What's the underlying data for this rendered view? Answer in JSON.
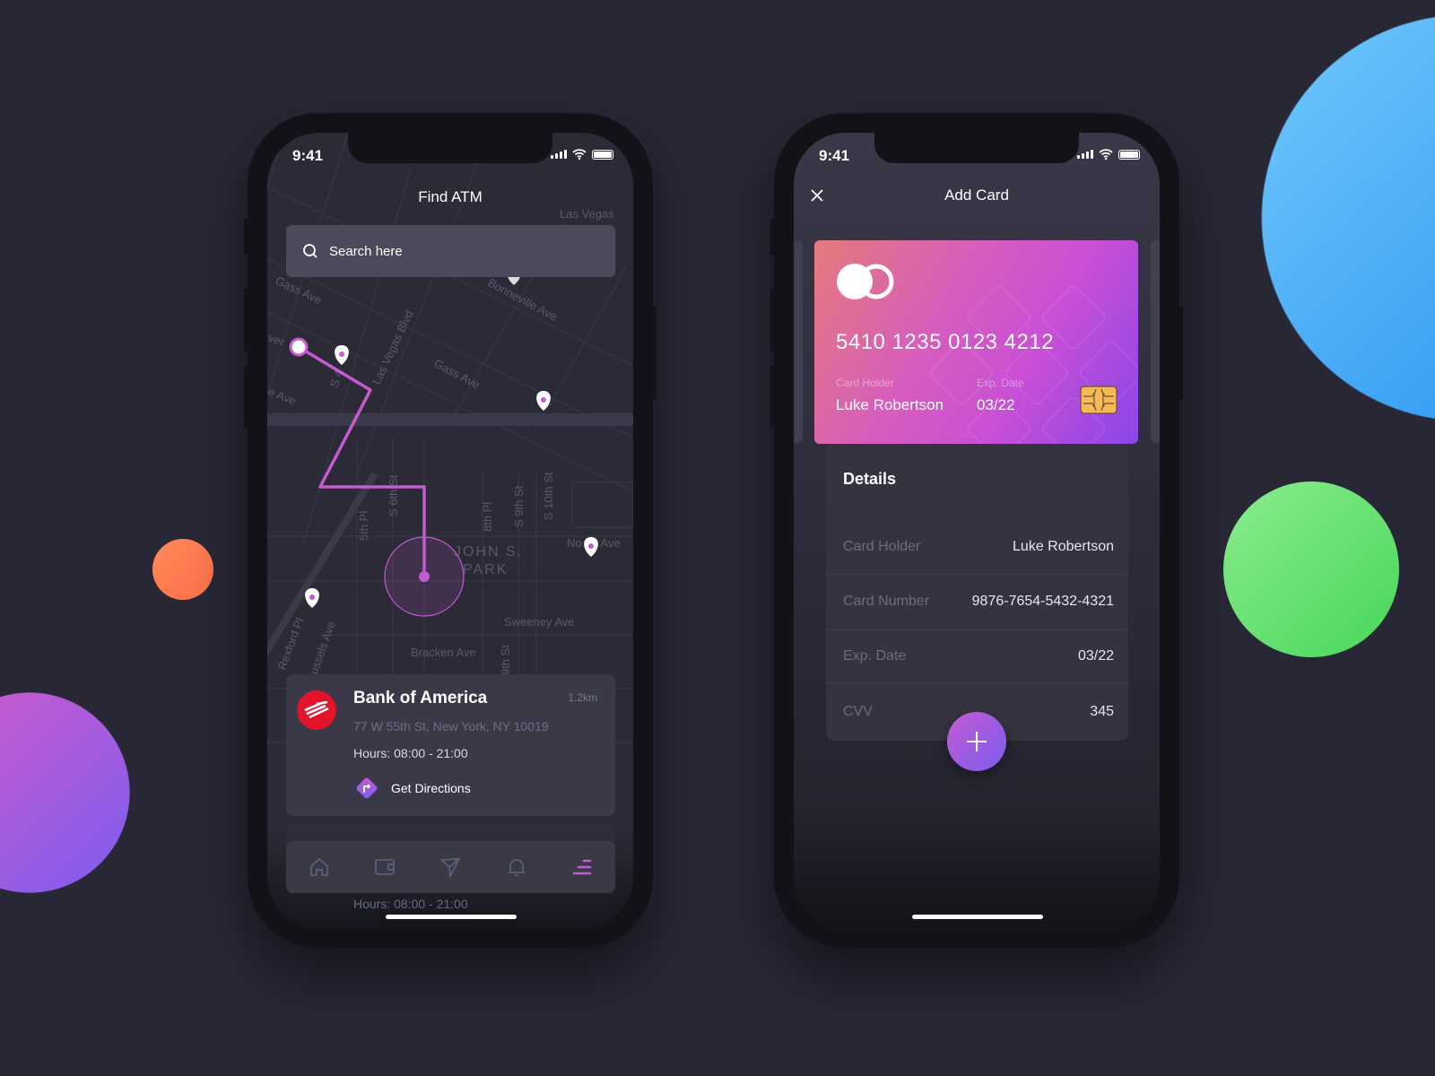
{
  "colors": {
    "background": "#272736",
    "accent": "#c45bd0",
    "route": "#c45bd0",
    "card_gradient": [
      "#e57a7a",
      "#c94fd6",
      "#8a46e8"
    ]
  },
  "decor": {
    "blobs": [
      {
        "color": "#4aaaf6"
      },
      {
        "color": "#56d866"
      },
      {
        "color": "#ff7e54"
      },
      {
        "color": "#9a5ae6"
      }
    ]
  },
  "status_bar": {
    "time": "9:41",
    "icons": [
      "signal-icon",
      "wifi-icon",
      "battery-icon"
    ]
  },
  "find_atm": {
    "title": "Find ATM",
    "search": {
      "placeholder": "Search here",
      "value": ""
    },
    "map_labels": [
      "Las Vegas",
      "Gass Ave",
      "Bonneville Ave",
      "Las Vegas Blvd",
      "Gass Ave",
      "ver",
      "e Ave",
      "S 4",
      "5th Pl",
      "S 6th St",
      "8th Pl",
      "S 9th St",
      "S 10th St",
      "JOHN S.",
      "PARK",
      "No   n Ave",
      "Sweeney Ave",
      "Bracken Ave",
      "Rexford Pl",
      "ussels Ave",
      "9th St"
    ],
    "atm": {
      "name": "Bank of America",
      "distance": "1.2km",
      "address": "77 W 55th St, New York, NY 10019",
      "hours": "Hours: 08:00 - 21:00",
      "directions_label": "Get Directions",
      "logo": "bank-of-america-logo"
    },
    "next_atm_hours": "Hours: 08:00 - 21:00",
    "nav": [
      {
        "icon": "home-icon",
        "active": false
      },
      {
        "icon": "wallet-icon",
        "active": false
      },
      {
        "icon": "send-icon",
        "active": false
      },
      {
        "icon": "bell-icon",
        "active": false
      },
      {
        "icon": "menu-icon",
        "active": true
      }
    ]
  },
  "add_card": {
    "title": "Add Card",
    "close_icon": "close-icon",
    "card": {
      "number": "5410 1235 0123 4212",
      "holder_label": "Card Holder",
      "holder": "Luke Robertson",
      "exp_label": "Exp. Date",
      "exp": "03/22",
      "brand_icon": "mastercard-icon",
      "chip_icon": "chip-icon"
    },
    "details": {
      "heading": "Details",
      "rows": [
        {
          "label": "Card Holder",
          "value": "Luke Robertson"
        },
        {
          "label": "Card Number",
          "value": "9876-7654-5432-4321"
        },
        {
          "label": "Exp. Date",
          "value": "03/22"
        },
        {
          "label": "CVV",
          "value": "345"
        }
      ]
    },
    "add_button_icon": "plus-icon"
  }
}
